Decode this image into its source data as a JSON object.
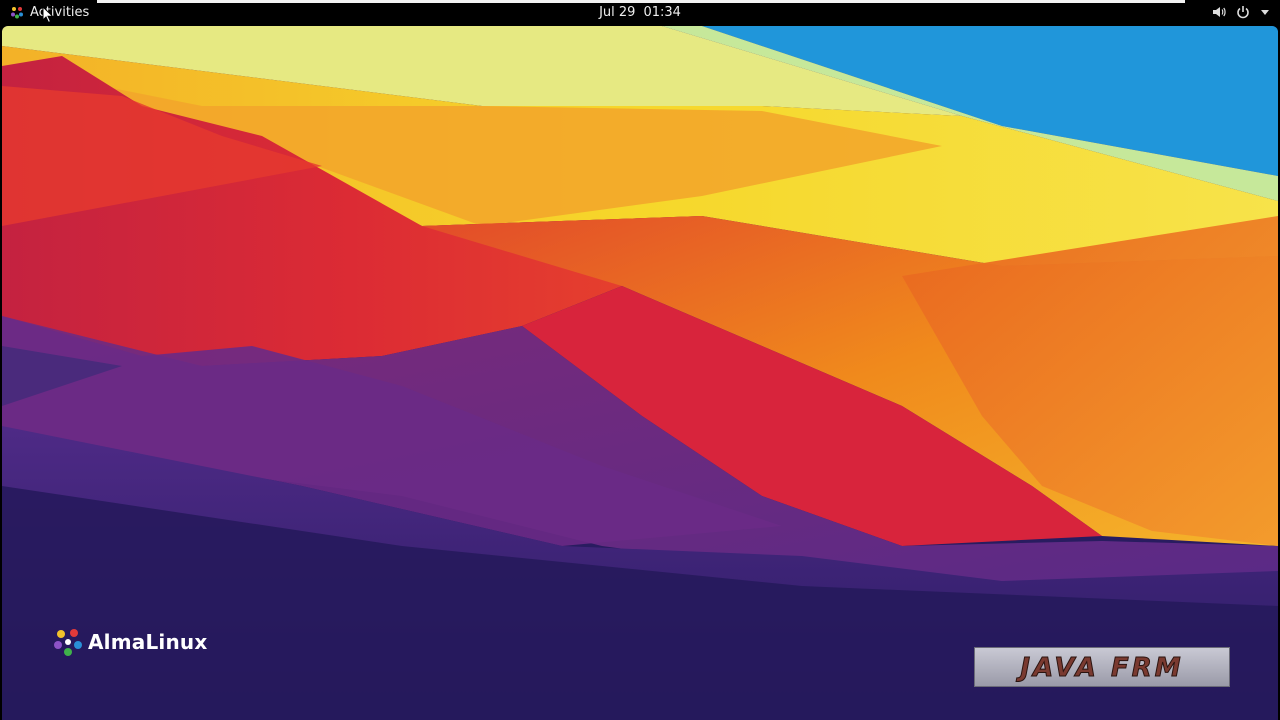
{
  "topbar": {
    "activities_label": "Activities",
    "date": "Jul 29",
    "time": "01:34",
    "icons": [
      "volume-icon",
      "power-icon",
      "chevron-down-icon"
    ]
  },
  "desktop": {
    "brand_name": "AlmaLinux",
    "watermark_text": "JAVA FRM"
  },
  "colors": {
    "topbar_bg": "#000000",
    "deep_purple": "#2a1a5e",
    "purple": "#6a2a8a",
    "red": "#d8283a",
    "orange": "#f07a1e",
    "yellow": "#f6d02a",
    "pale_yellow": "#e6e87a",
    "sky_blue": "#1b8fd6"
  }
}
